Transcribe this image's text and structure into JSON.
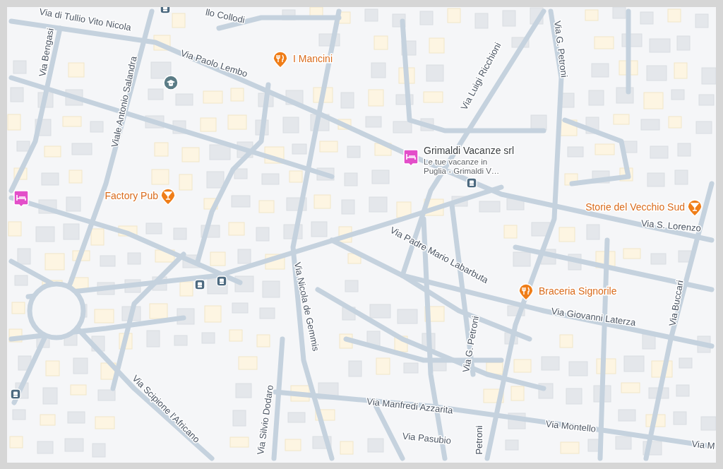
{
  "map": {
    "streets": [
      {
        "name": "Via di Tullio Vito Nicola"
      },
      {
        "name": "llo Collodi"
      },
      {
        "name": "Via Paolo Lembo"
      },
      {
        "name": "Via Bengasi"
      },
      {
        "name": "Viale Antonio Salandra"
      },
      {
        "name": "Via Luigi Ricchioni"
      },
      {
        "name": "Via G. Petroni"
      },
      {
        "name": "Via S. Lorenzo"
      },
      {
        "name": "Via Padre Mario Labarbuta"
      },
      {
        "name": "Via Giovanni Laterza"
      },
      {
        "name": "Via Buccari"
      },
      {
        "name": "Via Nicola de Gemmis"
      },
      {
        "name": "Via G. Petroni"
      },
      {
        "name": "Via Manfredi Azzarita"
      },
      {
        "name": "Via Montello"
      },
      {
        "name": "Via M"
      },
      {
        "name": "Via Pasubio"
      },
      {
        "name": "Petroni"
      },
      {
        "name": "Via Scipione l'Africano"
      },
      {
        "name": "Via Silvio Dodaro"
      }
    ],
    "places": [
      {
        "name": "I Mancini",
        "kind": "restaurant"
      },
      {
        "name": "Factory Pub",
        "kind": "bar"
      },
      {
        "name": "Grimaldi Vacanze srl",
        "kind": "hotel",
        "description": [
          "Le tue vacanze in",
          "Puglia - Grimaldi V…"
        ]
      },
      {
        "name": "Storie del Vecchio Sud",
        "kind": "bar"
      },
      {
        "name": "Braceria Signorile",
        "kind": "restaurant"
      },
      {
        "kind": "hotel"
      }
    ]
  }
}
